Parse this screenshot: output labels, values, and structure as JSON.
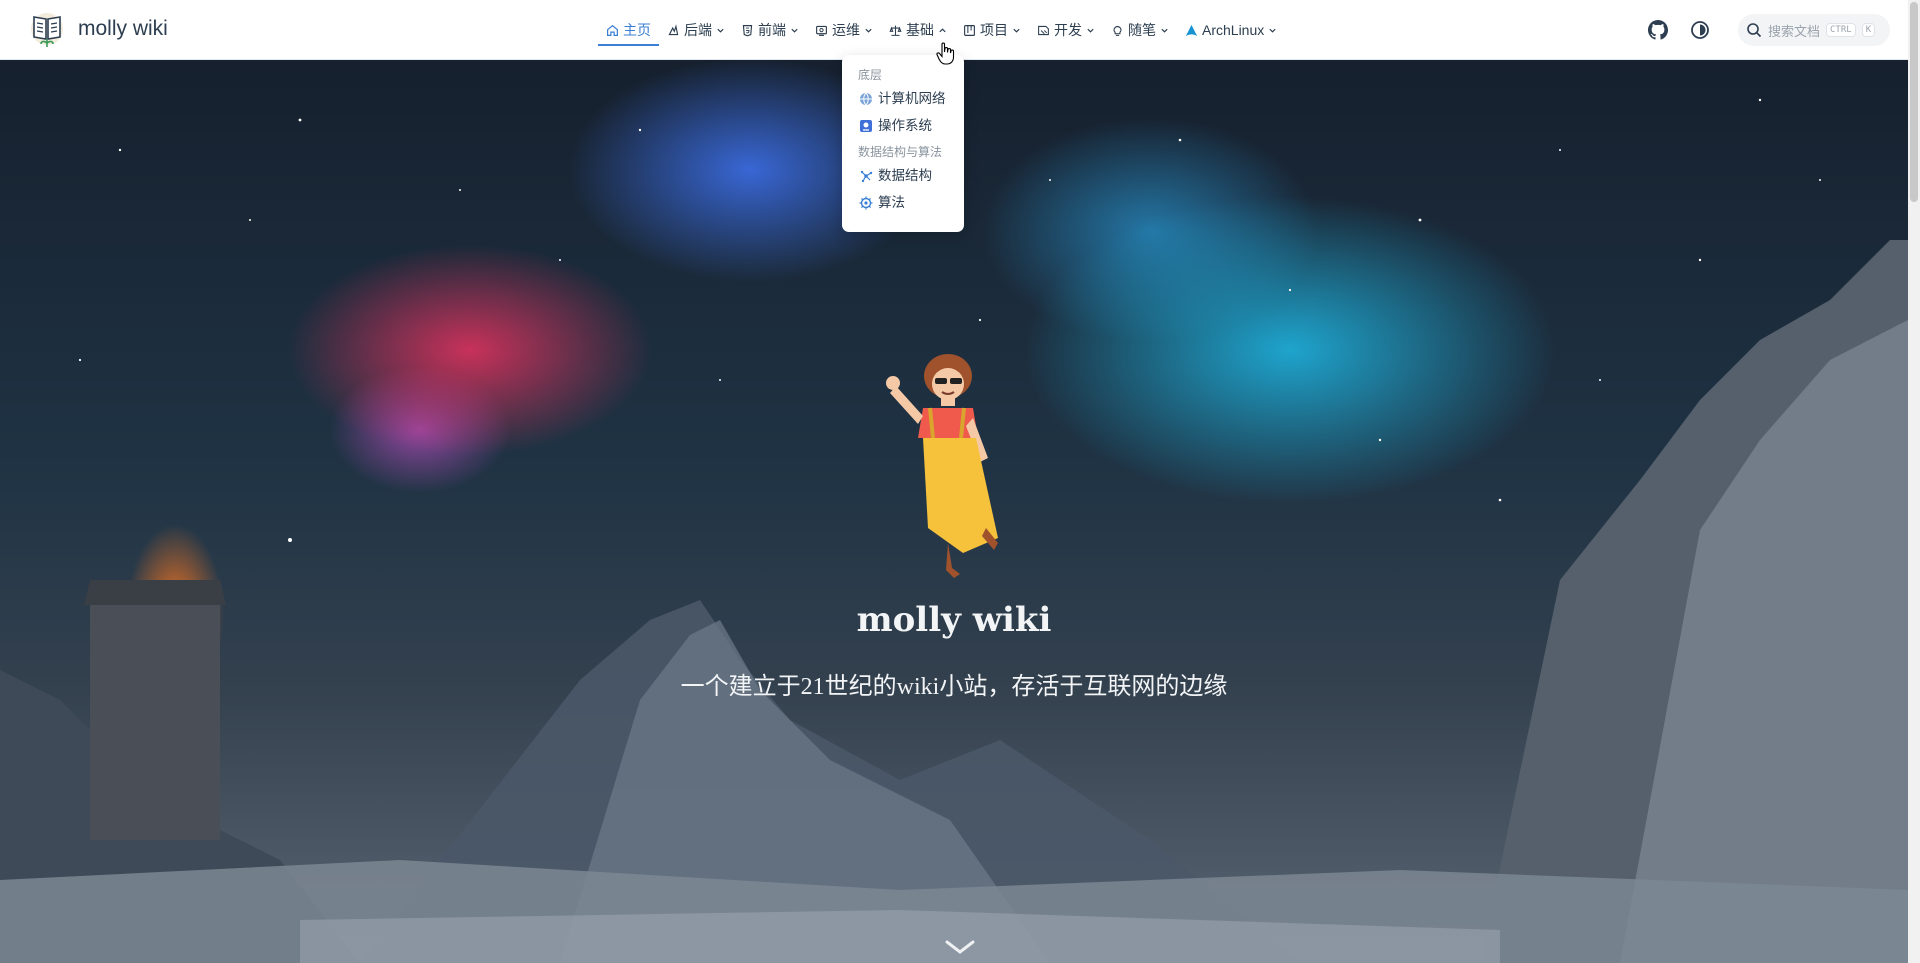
{
  "site": {
    "name": "molly wiki"
  },
  "nav": {
    "items": [
      {
        "label": "主页",
        "icon": "home-icon",
        "active": true
      },
      {
        "label": "后端",
        "icon": "backend-icon"
      },
      {
        "label": "前端",
        "icon": "html5-icon"
      },
      {
        "label": "运维",
        "icon": "ops-icon"
      },
      {
        "label": "基础",
        "icon": "foundation-icon",
        "open": true
      },
      {
        "label": "项目",
        "icon": "project-icon"
      },
      {
        "label": "开发",
        "icon": "dev-icon"
      },
      {
        "label": "随笔",
        "icon": "bulb-icon"
      },
      {
        "label": "ArchLinux",
        "icon": "archlinux-icon"
      }
    ]
  },
  "dropdown": {
    "groups": [
      {
        "title": "底层",
        "items": [
          {
            "label": "计算机网络",
            "icon": "network-icon"
          },
          {
            "label": "操作系统",
            "icon": "os-icon"
          }
        ]
      },
      {
        "title": "数据结构与算法",
        "items": [
          {
            "label": "数据结构",
            "icon": "datastructure-icon"
          },
          {
            "label": "算法",
            "icon": "algorithm-icon"
          }
        ]
      }
    ]
  },
  "search": {
    "placeholder": "搜索文档",
    "key_modifier": "CTRL",
    "key": "K"
  },
  "hero": {
    "title": "molly wiki",
    "subtitle": "一个建立于21世纪的wiki小站，存活于互联网的边缘"
  },
  "colors": {
    "accent": "#3a7fd4",
    "text": "#2c3e50"
  }
}
